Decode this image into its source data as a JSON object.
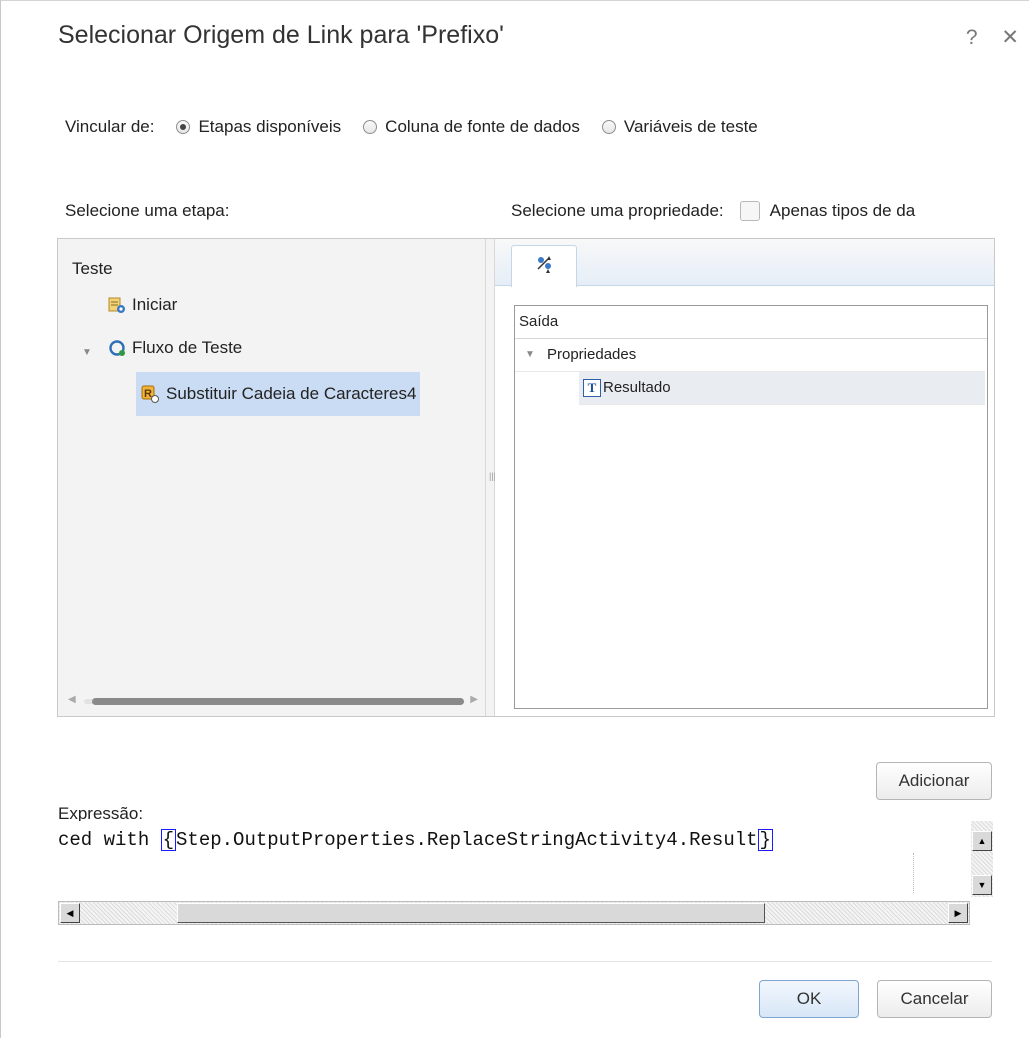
{
  "dialog": {
    "title": "Selecionar Origem de Link para 'Prefixo'",
    "help_label": "?",
    "close_label": "✕"
  },
  "link_from": {
    "label": "Vincular de:",
    "options": [
      {
        "label": "Etapas disponíveis",
        "checked": true
      },
      {
        "label": "Coluna de fonte de dados",
        "checked": false
      },
      {
        "label": "Variáveis de teste",
        "checked": false
      }
    ]
  },
  "left_section": {
    "label": "Selecione uma etapa:",
    "tree": {
      "root": "Teste",
      "items": [
        {
          "label": "Iniciar",
          "icon": "start-icon"
        },
        {
          "label": "Fluxo de Teste",
          "icon": "flow-icon",
          "expanded": true
        },
        {
          "label": "Substituir Cadeia de Caracteres4",
          "icon": "replace-activity-icon",
          "selected": true
        }
      ]
    }
  },
  "right_section": {
    "label": "Selecione uma propriedade:",
    "checkbox_label": "Apenas tipos de da",
    "checkbox_checked": false,
    "tab_icon": "output-properties-icon",
    "grid": {
      "header": "Saída",
      "rows": [
        {
          "label": "Propriedades",
          "expanded": true
        },
        {
          "label": "Resultado",
          "type_icon": "T",
          "selected": true
        }
      ]
    }
  },
  "add_button": "Adicionar",
  "expression": {
    "label": "Expressão:",
    "prefix": "ced with ",
    "brace_open": "{",
    "path": "Step.OutputProperties.ReplaceStringActivity4.Result",
    "brace_close": "}"
  },
  "footer": {
    "ok_label": "OK",
    "cancel_label": "Cancelar"
  },
  "colors": {
    "selection": "#cadcf3",
    "primary_button": "#d7e6f7",
    "brace_border": "#1a1aff"
  }
}
